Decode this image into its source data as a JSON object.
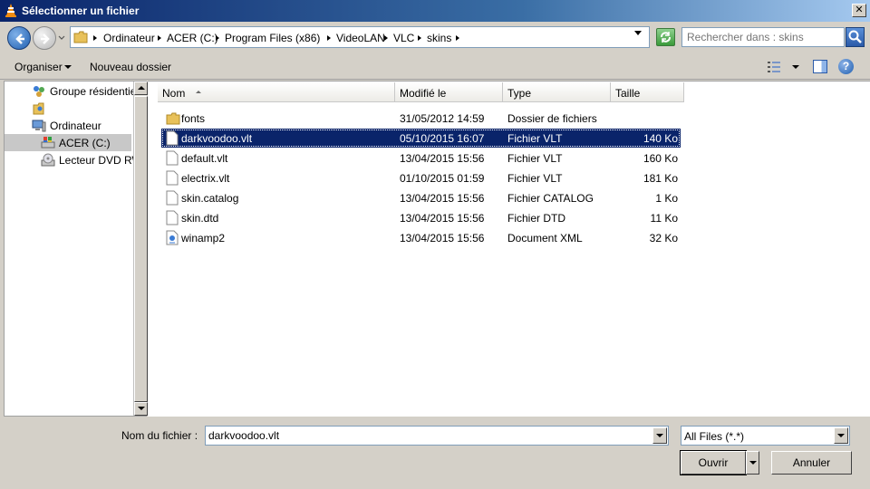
{
  "window": {
    "title": "Sélectionner un fichier",
    "close_glyph": "✕",
    "icon": "vlc-cone-icon"
  },
  "address": {
    "crumbs": [
      "Ordinateur",
      "ACER (C:)",
      "Program Files (x86)",
      "VideoLAN",
      "VLC",
      "skins"
    ]
  },
  "search": {
    "placeholder": "Rechercher dans : skins"
  },
  "toolbar": {
    "organize_label": "Organiser",
    "new_folder_label": "Nouveau dossier",
    "help_glyph": "?"
  },
  "nav": {
    "items": [
      {
        "label": "Groupe résidentiel",
        "icon": "homegroup-icon"
      },
      {
        "label": "",
        "icon": "user-folder-icon"
      },
      {
        "label": "Ordinateur",
        "icon": "computer-icon"
      },
      {
        "label": "ACER (C:)",
        "icon": "hard-drive-icon"
      },
      {
        "label": "Lecteur DVD RW",
        "icon": "dvd-drive-icon"
      }
    ]
  },
  "columns": {
    "name": "Nom",
    "modified": "Modifié le",
    "type": "Type",
    "size": "Taille"
  },
  "files": [
    {
      "name": "fonts",
      "modified": "31/05/2012 14:59",
      "type": "Dossier de fichiers",
      "size": "",
      "icon": "folder-icon"
    },
    {
      "name": "darkvoodoo.vlt",
      "modified": "05/10/2015 16:07",
      "type": "Fichier VLT",
      "size": "140 Ko",
      "icon": "file-icon"
    },
    {
      "name": "default.vlt",
      "modified": "13/04/2015 15:56",
      "type": "Fichier VLT",
      "size": "160 Ko",
      "icon": "file-icon"
    },
    {
      "name": "electrix.vlt",
      "modified": "01/10/2015 01:59",
      "type": "Fichier VLT",
      "size": "181 Ko",
      "icon": "file-icon"
    },
    {
      "name": "skin.catalog",
      "modified": "13/04/2015 15:56",
      "type": "Fichier CATALOG",
      "size": "1 Ko",
      "icon": "file-icon"
    },
    {
      "name": "skin.dtd",
      "modified": "13/04/2015 15:56",
      "type": "Fichier DTD",
      "size": "11 Ko",
      "icon": "file-icon"
    },
    {
      "name": "winamp2",
      "modified": "13/04/2015 15:56",
      "type": "Document XML",
      "size": "32 Ko",
      "icon": "xml-document-icon"
    }
  ],
  "selected_file_index": 1,
  "footer": {
    "filename_label": "Nom du fichier :",
    "filename_value": "darkvoodoo.vlt",
    "filter_value": "All Files (*.*)",
    "open_label": "Ouvrir",
    "cancel_label": "Annuler"
  },
  "colors": {
    "selection": "#0a246a",
    "titlebar_start": "#0a246a",
    "folder": "#e8c15a"
  }
}
